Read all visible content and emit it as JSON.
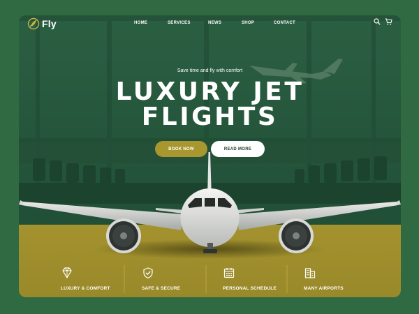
{
  "brand": {
    "name": "Fly"
  },
  "nav": {
    "links": [
      "HOME",
      "SERVICES",
      "NEWS",
      "SHOP",
      "CONTACT"
    ],
    "icons": [
      "search-icon",
      "cart-icon"
    ]
  },
  "hero": {
    "tagline": "Save time and fly with comfort",
    "title_line1": "LUXURY JET",
    "title_line2": "FLIGHTS",
    "book_button": "BOOK NOW",
    "read_button": "READ MORE"
  },
  "features": [
    {
      "label": "LUXURY & COMFORT",
      "icon": "diamond-icon"
    },
    {
      "label": "SAFE & SECURE",
      "icon": "shield-check-icon"
    },
    {
      "label": "PERSONAL SCHEDULE",
      "icon": "calendar-icon"
    },
    {
      "label": "MANY AIRPORTS",
      "icon": "building-icon"
    }
  ],
  "colors": {
    "page_background": "#2f6a43",
    "hero_green": "#23533a",
    "accent_gold": "#a8962f",
    "floor_gold": "#a3912e",
    "text": "#ffffff"
  }
}
